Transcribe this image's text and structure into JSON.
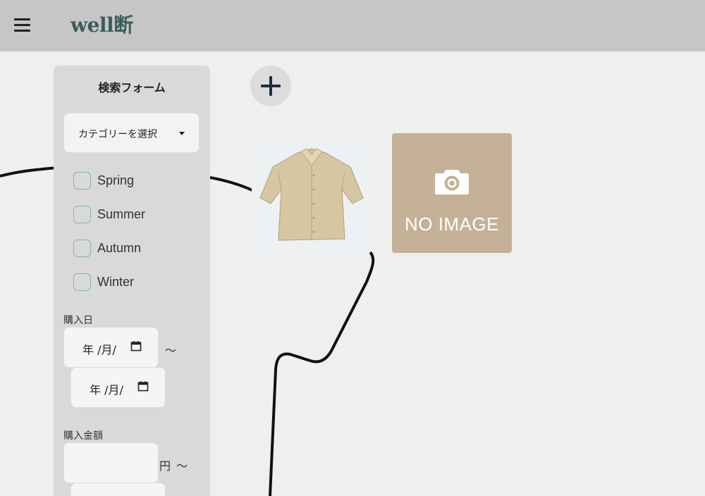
{
  "header": {
    "menu_icon": "hamburger-menu-icon",
    "logo": "well断"
  },
  "sidebar": {
    "title": "検索フォーム",
    "category_select": {
      "label": "カテゴリーを選択",
      "icon": "caret-down-icon"
    },
    "seasons": [
      {
        "label": "Spring",
        "checked": false
      },
      {
        "label": "Summer",
        "checked": false
      },
      {
        "label": "Autumn",
        "checked": false
      },
      {
        "label": "Winter",
        "checked": false
      }
    ],
    "purchase_date": {
      "label": "購入日",
      "from_placeholder": "年 /月/",
      "to_placeholder": "年 /月/",
      "separator": "～",
      "icon": "calendar-icon"
    },
    "purchase_amount": {
      "label": "購入金額",
      "unit": "円",
      "separator": "～",
      "from_value": "",
      "to_value": ""
    }
  },
  "main": {
    "add_button_icon": "plus-icon",
    "items": [
      {
        "type": "photo",
        "icon": "beige-shirt-image"
      },
      {
        "type": "placeholder",
        "text": "NO IMAGE",
        "icon": "camera-icon"
      }
    ]
  },
  "colors": {
    "header_bg": "#c6c6c6",
    "page_bg": "#efefef",
    "sidebar_bg": "#d9d9d9",
    "logo": "#3b5d5a",
    "checkbox_border": "#7fb5b8",
    "noimage_bg": "#c4b197",
    "add_icon": "#1f2d45"
  }
}
